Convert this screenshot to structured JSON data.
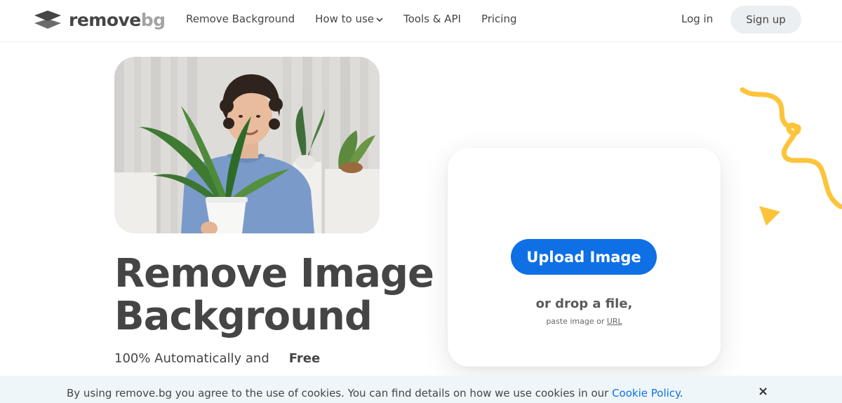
{
  "header": {
    "logo_text_main": "remove",
    "logo_text_accent": "bg",
    "nav": [
      {
        "label": "Remove Background"
      },
      {
        "label": "How to use"
      },
      {
        "label": "Tools & API"
      },
      {
        "label": "Pricing"
      }
    ],
    "login_label": "Log in",
    "signup_label": "Sign up"
  },
  "hero": {
    "headline_line1": "Remove Image",
    "headline_line2": "Background",
    "tagline": "100% Automatically and",
    "free_badge": "Free"
  },
  "upload": {
    "button_label": "Upload Image",
    "drop_text": "or drop a file,",
    "paste_prefix": "paste image or",
    "url_link": "URL"
  },
  "cookie": {
    "text": "By using remove.bg you agree to the use of cookies. You can find details on how we use cookies in our",
    "link": "Cookie Policy",
    "suffix": ".",
    "close_symbol": "×"
  },
  "colors": {
    "primary": "#0f70e6",
    "text": "#454545",
    "accent_yellow": "#fcc43a",
    "cookie_bg": "#eef6fa"
  },
  "icons": [
    "logo-layers-icon",
    "chevron-down-icon",
    "close-icon"
  ]
}
